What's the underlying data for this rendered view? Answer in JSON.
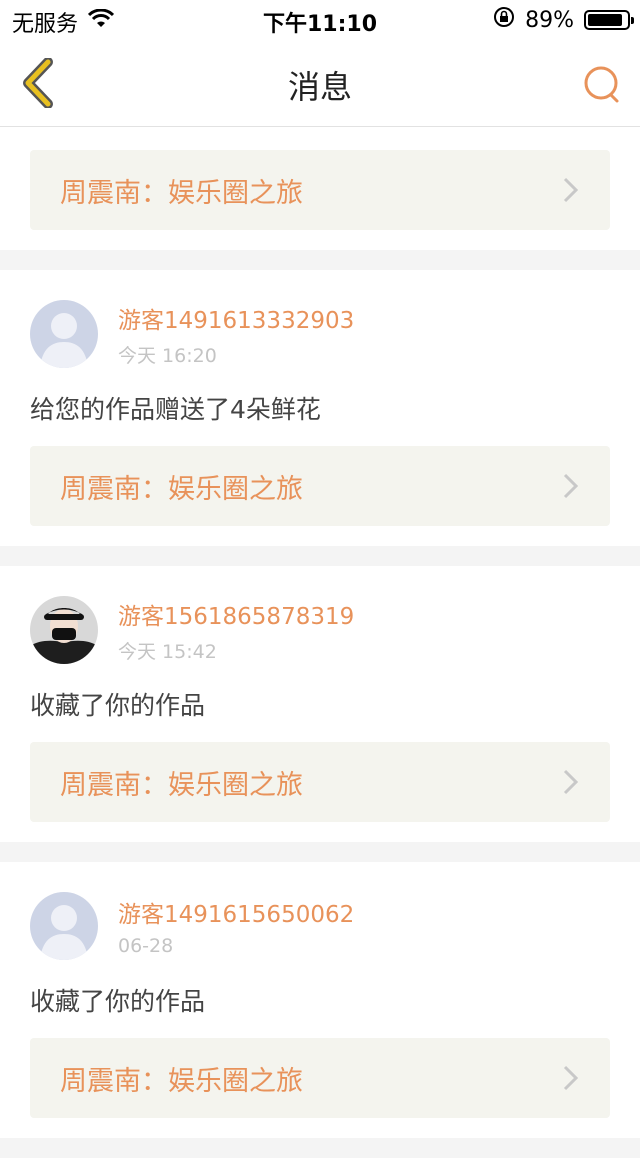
{
  "status_bar": {
    "carrier": "无服务",
    "time": "下午11:10",
    "battery_percent": "89%",
    "battery_level": 0.89
  },
  "navbar": {
    "title": "消息"
  },
  "messages": [
    {
      "work_title": "周震南：娱乐圈之旅"
    },
    {
      "username": "游客1491613332903",
      "time": "今天 16:20",
      "action": "给您的作品赠送了4朵鲜花",
      "work_title": "周震南：娱乐圈之旅",
      "avatar": "default-avatar"
    },
    {
      "username": "游客1561865878319",
      "time": "今天 15:42",
      "action": "收藏了你的作品",
      "work_title": "周震南：娱乐圈之旅",
      "avatar": "photo-avatar"
    },
    {
      "username": "游客1491615650062",
      "time": "06-28",
      "action": "收藏了你的作品",
      "work_title": "周震南：娱乐圈之旅",
      "avatar": "default-avatar"
    }
  ],
  "colors": {
    "accent": "#e8925a",
    "work_bg": "#f4f4ee",
    "back_icon": "#e8c020"
  }
}
